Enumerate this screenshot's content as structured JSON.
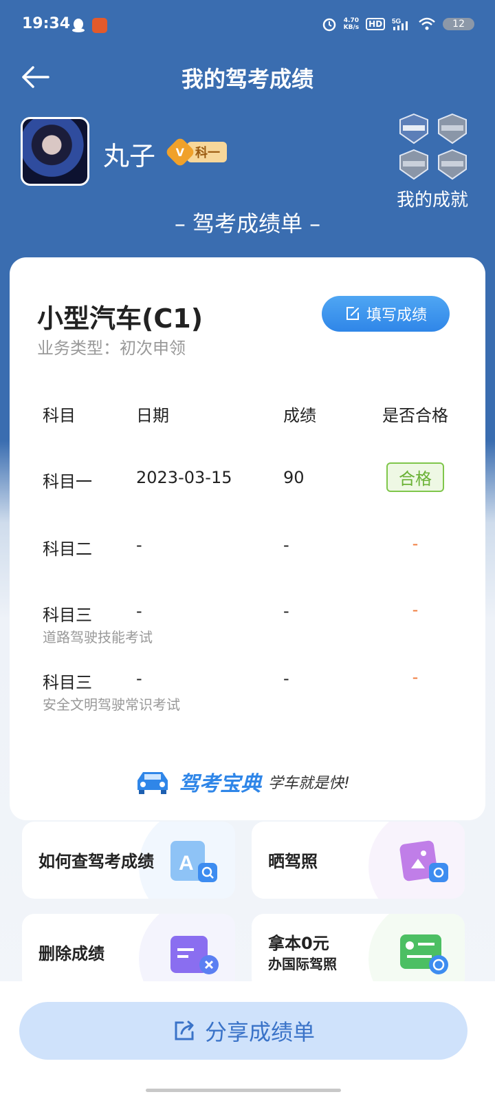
{
  "status_bar": {
    "time": "19:34",
    "net_speed_value": "4.70",
    "net_speed_unit": "KB/s",
    "hd": "HD",
    "signal": "5G",
    "battery": "12"
  },
  "header": {
    "title": "我的驾考成绩"
  },
  "profile": {
    "username": "丸子",
    "level_letter": "V",
    "level_text": "科一",
    "achievements_label": "我的成就"
  },
  "report": {
    "heading": "– 驾考成绩单 –",
    "vehicle_type": "小型汽车(C1)",
    "business_type": "业务类型：初次申领",
    "fill_button": "填写成绩",
    "columns": [
      "科目",
      "日期",
      "成绩",
      "是否合格"
    ],
    "rows": [
      {
        "subject": "科目一",
        "date": "2023-03-15",
        "score": "90",
        "result": "合格",
        "note": ""
      },
      {
        "subject": "科目二",
        "date": "-",
        "score": "-",
        "result": "-",
        "note": ""
      },
      {
        "subject": "科目三",
        "date": "-",
        "score": "-",
        "result": "-",
        "note": "道路驾驶技能考试"
      },
      {
        "subject": "科目三",
        "date": "-",
        "score": "-",
        "result": "-",
        "note": "安全文明驾驶常识考试"
      }
    ],
    "brand_name": "驾考宝典",
    "brand_slogan": "学车就是快!"
  },
  "tiles": {
    "check_scores": "如何查驾考成绩",
    "show_license": "晒驾照",
    "delete_scores": "删除成绩",
    "intl_license_line1": "拿本0元",
    "intl_license_line2": "办国际驾照"
  },
  "share_button": "分享成绩单",
  "colors": {
    "header_blue": "#3a6db0",
    "primary_blue": "#2f86e8",
    "pass_green": "#6ab236",
    "dash_orange": "#f07a3a"
  }
}
